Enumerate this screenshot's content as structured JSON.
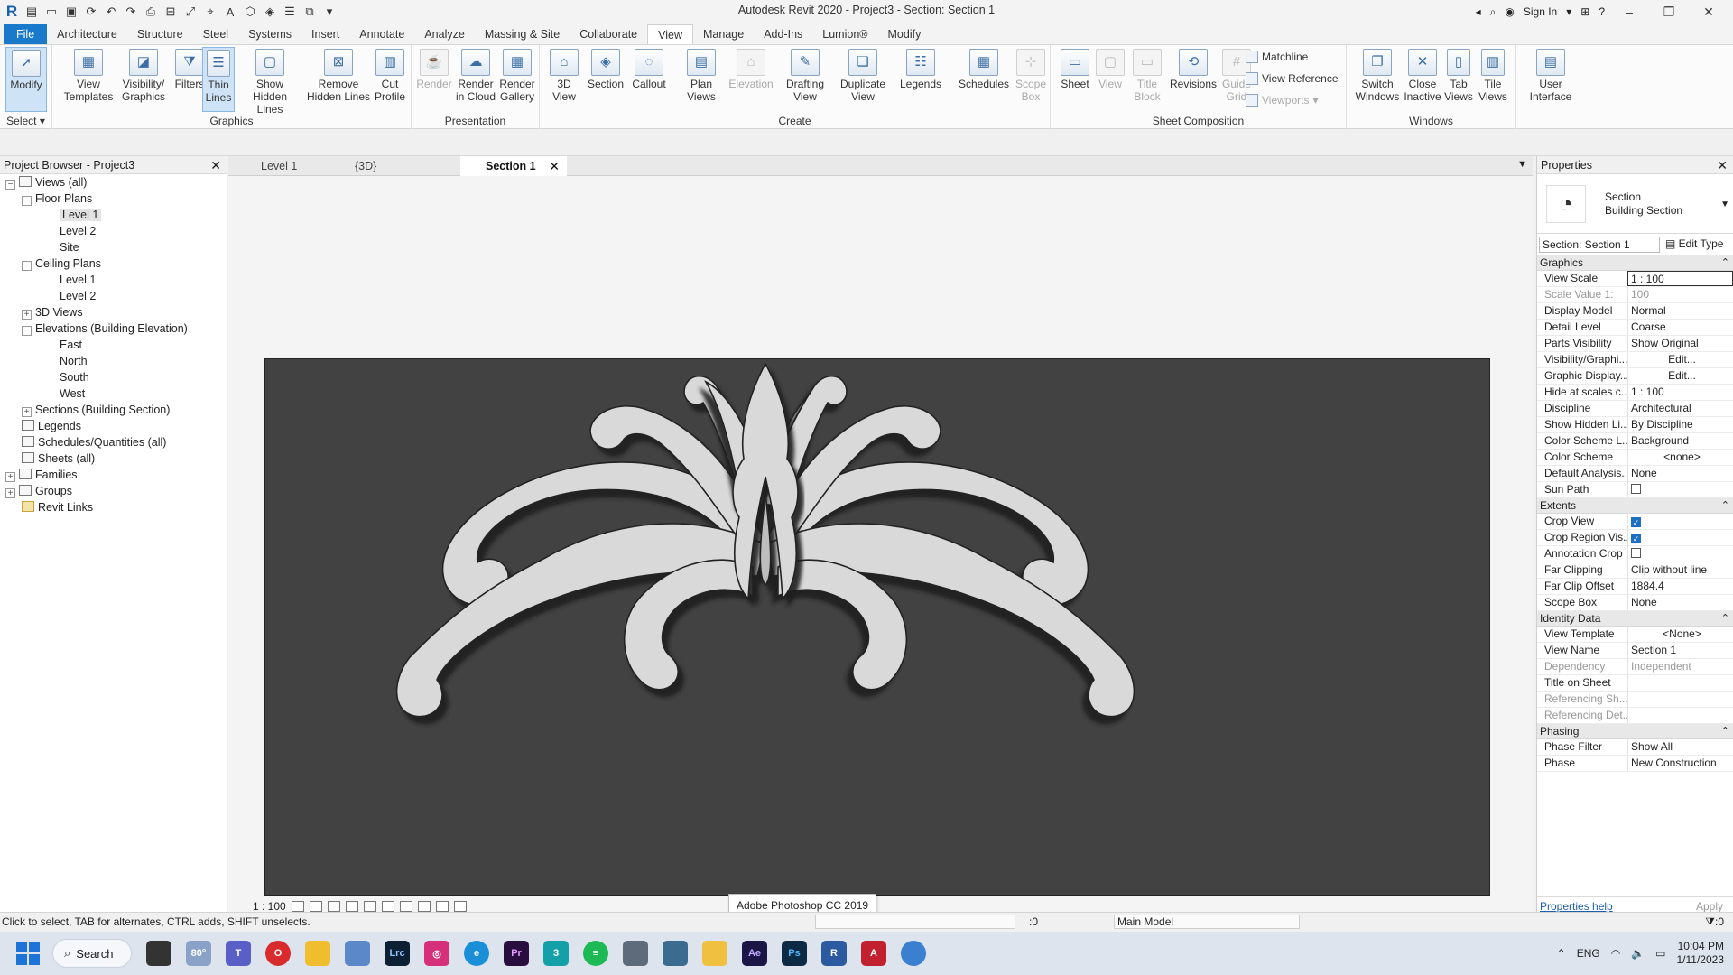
{
  "window": {
    "title": "Autodesk Revit 2020 - Project3 - Section: Section 1",
    "sign_in": "Sign In"
  },
  "ribbon_tabs": [
    "File",
    "Architecture",
    "Structure",
    "Steel",
    "Systems",
    "Insert",
    "Annotate",
    "Analyze",
    "Massing & Site",
    "Collaborate",
    "View",
    "Manage",
    "Add-Ins",
    "Lumion®",
    "Modify"
  ],
  "active_tab": "View",
  "ribbon": {
    "select": {
      "modify": "Modify",
      "select_label": "Select"
    },
    "graphics": {
      "label": "Graphics",
      "view_templates": [
        "View",
        "Templates"
      ],
      "visibility": [
        "Visibility/",
        "Graphics"
      ],
      "filters": "Filters",
      "thin_lines": [
        "Thin",
        "Lines"
      ],
      "show_hidden": [
        "Show",
        "Hidden Lines"
      ],
      "remove_hidden": [
        "Remove",
        "Hidden Lines"
      ],
      "cut_profile": [
        "Cut",
        "Profile"
      ]
    },
    "presentation": {
      "label": "Presentation",
      "render": "Render",
      "render_cloud": [
        "Render",
        "in Cloud"
      ],
      "render_gallery": [
        "Render",
        "Gallery"
      ]
    },
    "create": {
      "label": "Create",
      "view3d": [
        "3D",
        "View"
      ],
      "section": "Section",
      "callout": "Callout",
      "plan_views": [
        "Plan",
        "Views"
      ],
      "elevation": "Elevation",
      "drafting": [
        "Drafting",
        "View"
      ],
      "duplicate": [
        "Duplicate",
        "View"
      ],
      "legends": "Legends",
      "schedules": "Schedules",
      "scope_box": [
        "Scope",
        "Box"
      ]
    },
    "sheet_composition": {
      "label": "Sheet Composition",
      "sheet": "Sheet",
      "view": "View",
      "title_block": [
        "Title",
        "Block"
      ],
      "revisions": "Revisions",
      "guide_grid": [
        "Guide",
        "Grid"
      ],
      "matchline": "Matchline",
      "view_reference": "View  Reference",
      "viewports": "Viewports"
    },
    "windows": {
      "label": "Windows",
      "switch": [
        "Switch",
        "Windows"
      ],
      "close_inactive": [
        "Close",
        "Inactive"
      ],
      "tab_views": [
        "Tab",
        "Views"
      ],
      "tile_views": [
        "Tile",
        "Views"
      ]
    },
    "user_interface": [
      "User",
      "Interface"
    ]
  },
  "project_browser": {
    "title": "Project Browser - Project3",
    "views_all": "Views (all)",
    "floor_plans": "Floor Plans",
    "fp_level1": "Level 1",
    "fp_level2": "Level 2",
    "fp_site": "Site",
    "ceiling_plans": "Ceiling Plans",
    "cp_level1": "Level 1",
    "cp_level2": "Level 2",
    "views3d": "3D Views",
    "elevations": "Elevations (Building Elevation)",
    "east": "East",
    "north": "North",
    "south": "South",
    "west": "West",
    "sections": "Sections (Building Section)",
    "legends": "Legends",
    "schedules": "Schedules/Quantities (all)",
    "sheets": "Sheets (all)",
    "families": "Families",
    "groups": "Groups",
    "revit_links": "Revit Links"
  },
  "doc_tabs": [
    "Level 1",
    "{3D}",
    "Section 1"
  ],
  "view_bar": {
    "scale": "1 : 100"
  },
  "tooltip": "Adobe Photoshop CC 2019",
  "properties": {
    "title": "Properties",
    "type_line1": "Section",
    "type_line2": "Building Section",
    "selector": "Section: Section 1",
    "edit_type": "Edit Type",
    "groups": {
      "graphics": "Graphics",
      "extents": "Extents",
      "identity": "Identity Data",
      "phasing": "Phasing"
    },
    "graphics_rows": [
      {
        "k": "View Scale",
        "v": "1 : 100"
      },
      {
        "k": "Scale Value    1:",
        "v": "100"
      },
      {
        "k": "Display Model",
        "v": "Normal"
      },
      {
        "k": "Detail Level",
        "v": "Coarse"
      },
      {
        "k": "Parts Visibility",
        "v": "Show Original"
      },
      {
        "k": "Visibility/Graphi...",
        "v": "Edit..."
      },
      {
        "k": "Graphic Display...",
        "v": "Edit..."
      },
      {
        "k": "Hide at scales c...",
        "v": "1 : 100"
      },
      {
        "k": "Discipline",
        "v": "Architectural"
      },
      {
        "k": "Show Hidden Li...",
        "v": "By Discipline"
      },
      {
        "k": "Color Scheme L...",
        "v": "Background"
      },
      {
        "k": "Color Scheme",
        "v": "<none>"
      },
      {
        "k": "Default Analysis...",
        "v": "None"
      },
      {
        "k": "Sun Path",
        "v": ""
      }
    ],
    "extents_rows": [
      {
        "k": "Crop View",
        "v": ""
      },
      {
        "k": "Crop Region Vis...",
        "v": ""
      },
      {
        "k": "Annotation Crop",
        "v": ""
      },
      {
        "k": "Far Clipping",
        "v": "Clip without line"
      },
      {
        "k": "Far Clip Offset",
        "v": "1884.4"
      },
      {
        "k": "Scope Box",
        "v": "None"
      }
    ],
    "identity_rows": [
      {
        "k": "View Template",
        "v": "<None>"
      },
      {
        "k": "View Name",
        "v": "Section 1"
      },
      {
        "k": "Dependency",
        "v": "Independent"
      },
      {
        "k": "Title on Sheet",
        "v": ""
      },
      {
        "k": "Referencing Sh...",
        "v": ""
      },
      {
        "k": "Referencing Det...",
        "v": ""
      }
    ],
    "phasing_rows": [
      {
        "k": "Phase Filter",
        "v": "Show All"
      },
      {
        "k": "Phase",
        "v": "New Construction"
      }
    ],
    "help": "Properties help",
    "apply": "Apply"
  },
  "status": {
    "message": "Click to select, TAB for alternates, CTRL adds, SHIFT unselects.",
    "zero": ":0",
    "model": "Main Model",
    "filter": ":0"
  },
  "taskbar": {
    "search": "Search",
    "temp": "80°",
    "lang": "ENG",
    "time": "10:04 PM",
    "date": "1/11/2023"
  },
  "colors": {
    "accent": "#1979ca",
    "viewport_bg": "#424242",
    "ornament": "#d9d9d9"
  }
}
